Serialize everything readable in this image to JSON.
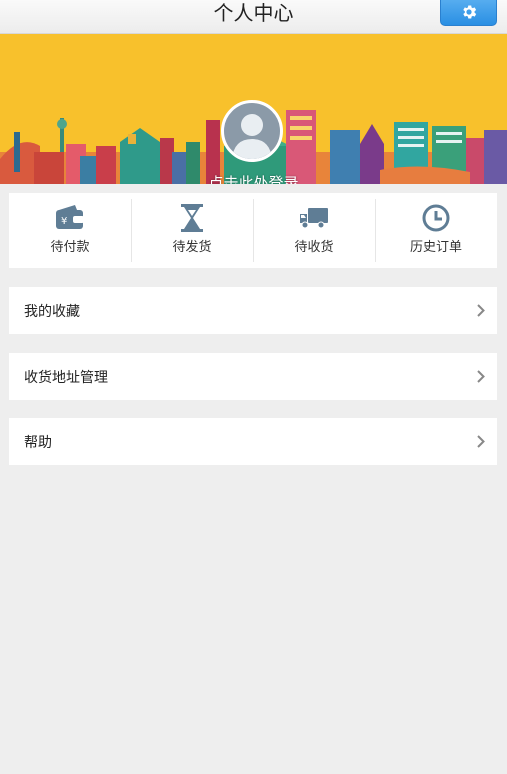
{
  "header": {
    "title": "个人中心",
    "settings_icon": "gear-icon"
  },
  "profile": {
    "login_text": "点击此处登录",
    "avatar_icon": "user-avatar-icon"
  },
  "orders": [
    {
      "label": "待付款",
      "icon": "wallet-icon"
    },
    {
      "label": "待发货",
      "icon": "hourglass-icon"
    },
    {
      "label": "待收货",
      "icon": "truck-icon"
    },
    {
      "label": "历史订单",
      "icon": "clock-icon"
    }
  ],
  "menu": [
    {
      "label": "我的收藏"
    },
    {
      "label": "收货地址管理"
    },
    {
      "label": "帮助"
    }
  ],
  "colors": {
    "accent": "#2a8fe3",
    "banner": "#f8c12c",
    "icon": "#5f7d95"
  }
}
